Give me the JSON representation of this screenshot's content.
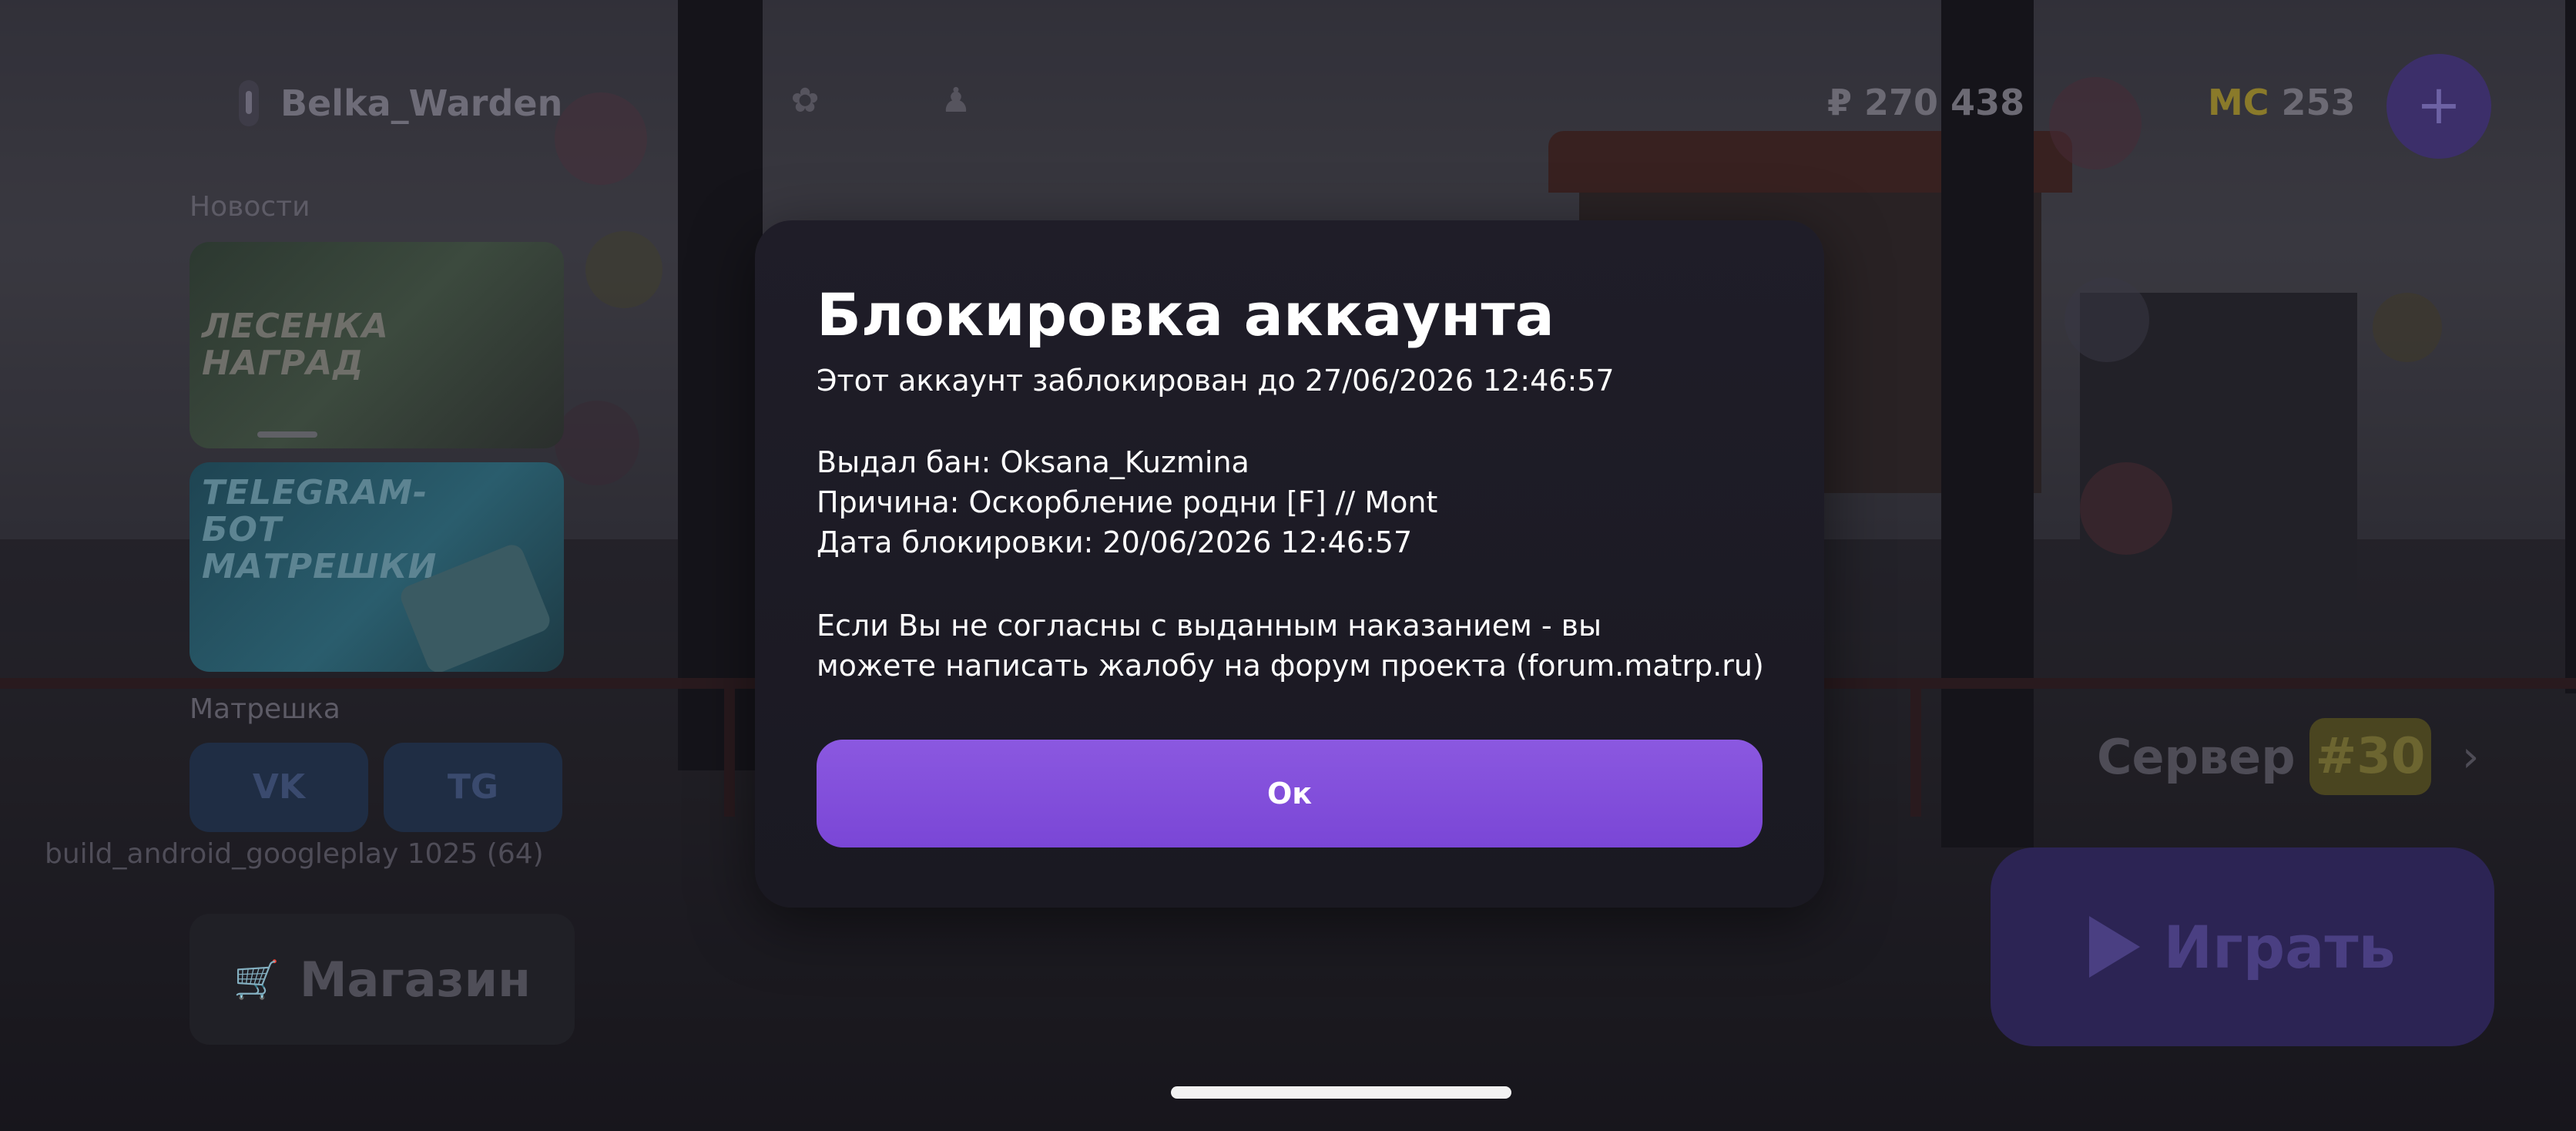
{
  "player": {
    "name": "Belka_Warden"
  },
  "balance": {
    "rubles": "₽ 270 438",
    "mc_symbol": "MC",
    "mc_value": "253",
    "plus": "+"
  },
  "icons": {
    "settings": "gear-icon",
    "profile": "person-icon",
    "shop": "cart-icon",
    "play": "play-icon"
  },
  "sidebar": {
    "news_label": "Новости",
    "news": [
      {
        "title": "ЛЕСЕНКА НАГРАД"
      },
      {
        "title": "TELEGRAM-БОТ МАТРЕШКИ"
      }
    ],
    "social_label": "Матрешка",
    "social": [
      {
        "label": "VK"
      },
      {
        "label": "TG"
      }
    ],
    "version": "build_android_googleplay 1025 (64)",
    "shop_label": "Магазин"
  },
  "server": {
    "label": "Сервер",
    "number": "#30"
  },
  "play_label": "Играть",
  "modal": {
    "title": "Блокировка аккаунта",
    "line_blocked_until": "Этот аккаунт заблокирован до 27/06/2026 12:46:57",
    "line_issued_by": "Выдал бан: Oksana_Kuzmina",
    "line_reason": "Причина: Оскорбление родни [F] // Mont",
    "line_date": "Дата блокировки: 20/06/2026 12:46:57",
    "line_appeal_1": "Если Вы не согласны с выданным наказанием - вы",
    "line_appeal_2": "можете написать жалобу на форум проекта (forum.matrp.ru)",
    "ok_label": "Ок"
  },
  "colors": {
    "accent": "#8052db",
    "modal_bg": "#1d1b25",
    "server_badge": "#4a4520"
  }
}
